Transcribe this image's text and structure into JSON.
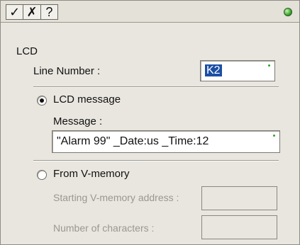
{
  "toolbar": {
    "ok_icon": "✓",
    "cancel_icon": "✗",
    "help_icon": "?",
    "status_color": "#3aa52a"
  },
  "section_title": "LCD",
  "line_number": {
    "label": "Line Number :",
    "value": "K2"
  },
  "lcd_message": {
    "radio_label": "LCD message",
    "selected": true,
    "message_label": "Message :",
    "message_value": "\"Alarm 99\"  _Date:us   _Time:12"
  },
  "from_vmemory": {
    "radio_label": "From V-memory",
    "selected": false,
    "start_address_label": "Starting V-memory address :",
    "start_address_value": "",
    "num_chars_label": "Number of characters :",
    "num_chars_value": ""
  }
}
